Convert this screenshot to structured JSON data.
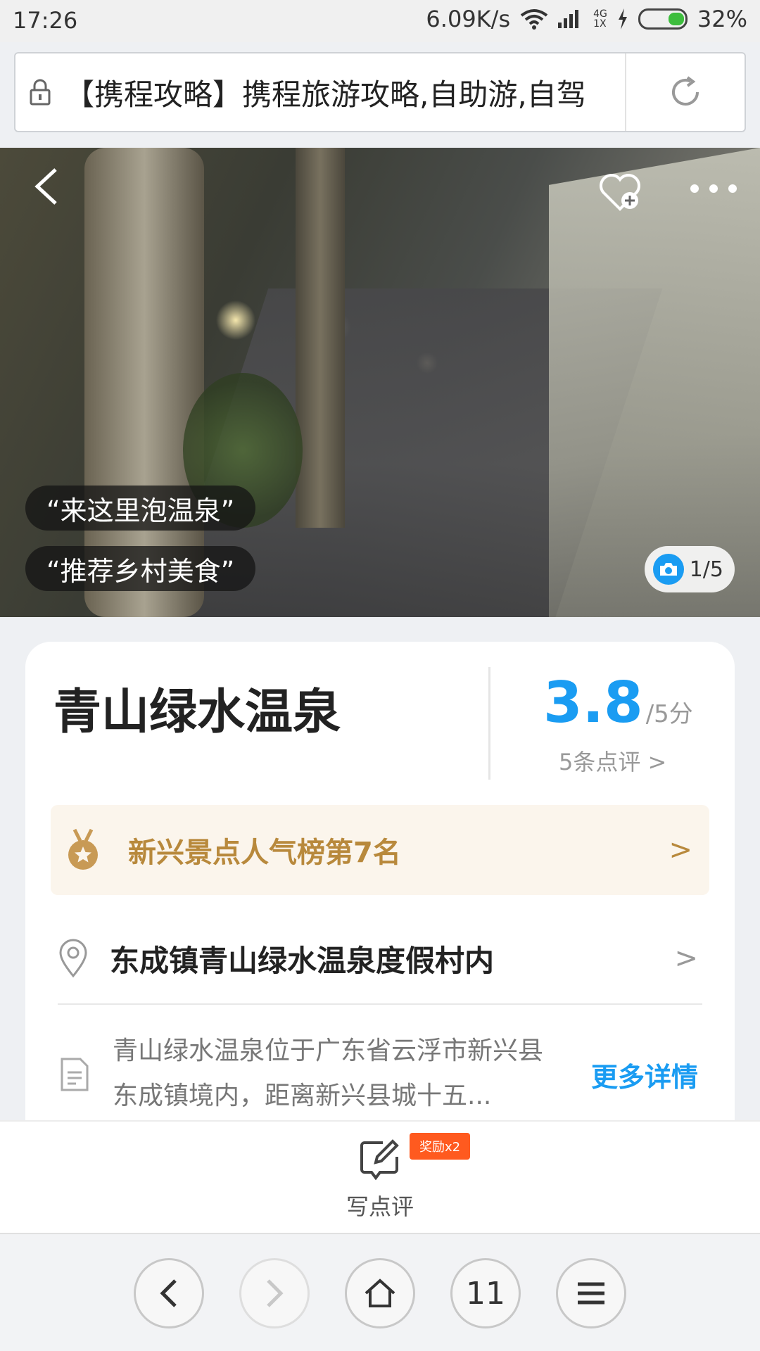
{
  "status_bar": {
    "time": "17:26",
    "net_speed": "6.09K/s",
    "net_type_top": "4G",
    "net_type_bottom": "1X",
    "battery": "32%"
  },
  "address_bar": {
    "url_text": "【携程攻略】携程旅游攻略,自助游,自驾"
  },
  "hero": {
    "tags": [
      "“来这里泡温泉”",
      "“推荐乡村美食”"
    ],
    "photo_counter": "1/5"
  },
  "attraction": {
    "name": "青山绿水温泉",
    "score": "3.8",
    "score_max": "/5分",
    "reviews_link": "5条点评 >",
    "rank_text": "新兴景点人气榜第7名",
    "address": "东成镇青山绿水温泉度假村内",
    "description": "青山绿水温泉位于广东省云浮市新兴县东成镇境内，距离新兴县城十五...",
    "more_details": "更多详情"
  },
  "write_review": {
    "label": "写点评",
    "badge": "奖励x2"
  },
  "browser_nav": {
    "tab_count": "11"
  },
  "colors": {
    "accent_blue": "#1a9cf2",
    "rank_gold": "#b8893c",
    "reward_orange": "#ff5a1f"
  }
}
